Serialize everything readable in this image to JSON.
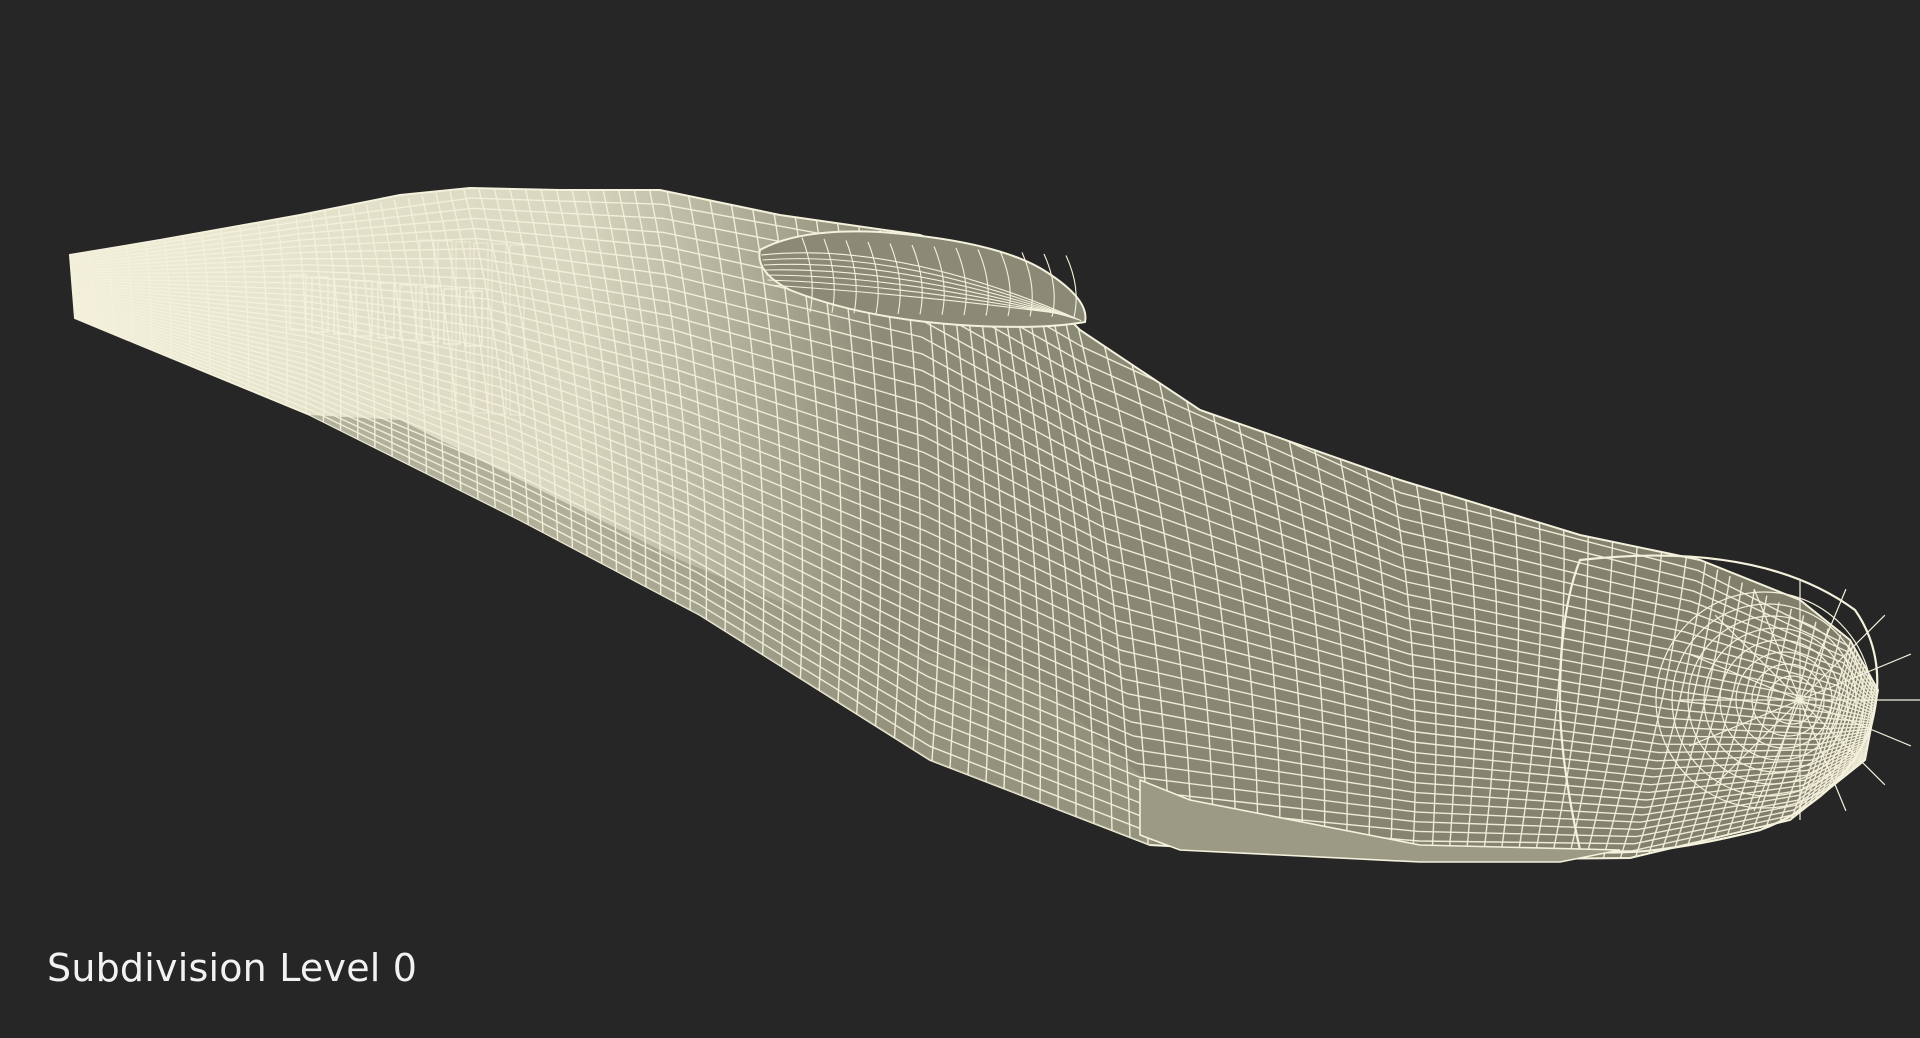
{
  "caption": {
    "text": "Subdivision Level 0"
  },
  "scene": {
    "background_color": "#262626",
    "model_fill_color": "#84836f",
    "model_side_fill_color": "#a6a48c",
    "tail_fill_color": "#efeed8",
    "wire_color": "#f4f1dc",
    "subject": "high-speed-train-nose-wireframe",
    "render_mode": "wireframe-on-shaded"
  }
}
